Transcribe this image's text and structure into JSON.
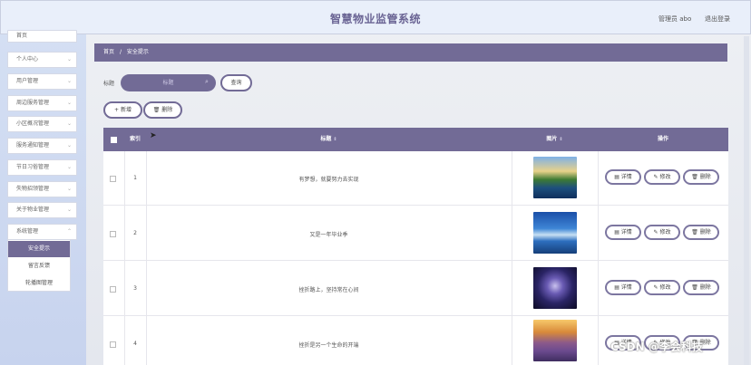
{
  "header": {
    "title": "智慧物业监管系统",
    "user": "管理员 abo",
    "logout": "退出登录"
  },
  "sidebar": {
    "items": [
      {
        "label": "首页"
      },
      {
        "label": "个人中心"
      },
      {
        "label": "用户管理"
      },
      {
        "label": "周边服务管理"
      },
      {
        "label": "小区概况管理"
      },
      {
        "label": "服务通知管理"
      },
      {
        "label": "节日习俗管理"
      },
      {
        "label": "失物招领管理"
      },
      {
        "label": "关于物业管理"
      },
      {
        "label": "系统管理"
      }
    ],
    "submenu": [
      {
        "label": "安全提示",
        "active": true
      },
      {
        "label": "留言反馈"
      },
      {
        "label": "轮播图管理"
      }
    ]
  },
  "breadcrumb": {
    "home": "首页",
    "separator": "/",
    "current": "安全提示"
  },
  "search": {
    "label": "标题",
    "placeholder": "标题",
    "button": "查询"
  },
  "actions": {
    "add": "+ 新增",
    "delete": "🗑 删除"
  },
  "table": {
    "headers": {
      "index": "索引",
      "title": "标题",
      "image": "图片",
      "ops": "操作"
    },
    "rows": [
      {
        "index": "1",
        "title": "有梦想，就要努力去实现"
      },
      {
        "index": "2",
        "title": "又是一年毕业季"
      },
      {
        "index": "3",
        "title": "挫折路上，坚持常在心间"
      },
      {
        "index": "4",
        "title": "挫折是另一个生命的开端"
      }
    ],
    "ops": {
      "detail": "详情",
      "edit": "修改",
      "delete": "删除"
    }
  },
  "watermark": "CSDN @李会科技",
  "colors": {
    "accent": "#726b96",
    "header_bg": "#e9effa",
    "sidebar_bg": "#c7d3ee"
  }
}
